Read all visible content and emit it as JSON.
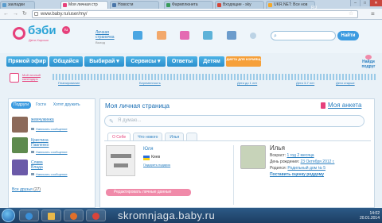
{
  "browser": {
    "tabs": [
      {
        "label": "закладки",
        "fav": "#5b9ccc",
        "active": false
      },
      {
        "label": "Моя личная стр",
        "fav": "#e6407b",
        "active": true
      },
      {
        "label": "Новости",
        "fav": "#4a76a8",
        "active": false
      },
      {
        "label": "Фармплюнета",
        "fav": "#3a9b5a",
        "active": false
      },
      {
        "label": "Входящие - sky",
        "fav": "#d44638",
        "active": false
      },
      {
        "label": "UKR.NET: Все нов",
        "fav": "#f4a82a",
        "active": false
      }
    ],
    "url": "www.baby.ru/user/my/",
    "window_buttons": [
      "–",
      "□",
      "✕"
    ]
  },
  "header": {
    "logo": "бэби",
    "logo_domain": "ru",
    "logo_sub": "Дети-Хорошо",
    "personal_page_link": "Личная страничка",
    "exit": "Выход",
    "search_placeholder": "",
    "search_button": "Найти"
  },
  "menu": {
    "items": [
      "Прямой эфир",
      "Общайся",
      "Выбирай ▾",
      "Сервисы ▾",
      "Ответы",
      "Детям"
    ],
    "diet_badge": "ДИЕТА ДЛЯ КОРМЯЩ",
    "find_friend": "Найди подруг"
  },
  "calendar": {
    "link": "Мой личный календарь",
    "labels": [
      "Планирование",
      "Беременность",
      "Дети до 1 лет",
      "Дети 3-7 лет",
      "Дети старше"
    ]
  },
  "friends": {
    "tabs": [
      "Подруги",
      "Гости",
      "Хотят дружить"
    ],
    "list": [
      {
        "name": "жемчужинка",
        "message": "Написать сообщение",
        "avatar": "#8c6a5a"
      },
      {
        "name": "Кристина Павленко",
        "message": "Написать сообщение",
        "avatar": "#5e8a4e"
      },
      {
        "name": "Слава Влада",
        "message": "Написать сообщение",
        "avatar": "#6b5aa8"
      }
    ],
    "all_label": "Все друзья",
    "all_count": "(27)"
  },
  "profile": {
    "title": "Моя личная страница",
    "anketa": "Моя анкета",
    "status_placeholder": "Я думаю...",
    "tabs": [
      "О Себе",
      "Что нового",
      "Илья"
    ],
    "user_name": "Юля",
    "city": "Киев",
    "gift": "Подарить подарок",
    "edit_button": "Редактировать личные данные",
    "child": {
      "name": "Илья",
      "age_label": "Возраст:",
      "age": "1 год 2 месяца",
      "birthday_label": "День рождения:",
      "birthday": "23 Октября 2012 г.",
      "hospital_label": "Родился:",
      "hospital": "Родильный дом № 5",
      "link": "Поставить оценку роддому"
    }
  },
  "taskbar": {
    "watermark": "skromnjaga.baby.ru",
    "lang": "RU",
    "time": "14:02",
    "date": "20.01.2014"
  }
}
